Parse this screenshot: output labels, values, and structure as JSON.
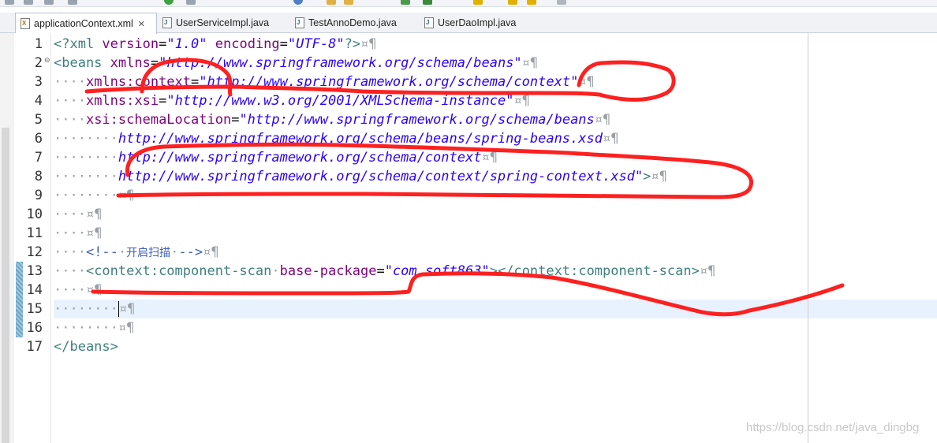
{
  "tabs": [
    {
      "label": "applicationContext.xml",
      "icon": "xml-file-icon",
      "active": true,
      "close": "✕"
    },
    {
      "label": "UserServiceImpl.java",
      "icon": "java-file-icon",
      "active": false
    },
    {
      "label": "TestAnnoDemo.java",
      "icon": "java-file-icon",
      "active": false
    },
    {
      "label": "UserDaoImpl.java",
      "icon": "java-file-icon",
      "active": false
    }
  ],
  "line_numbers": [
    "1",
    "2",
    "3",
    "4",
    "5",
    "6",
    "7",
    "8",
    "9",
    "10",
    "11",
    "12",
    "13",
    "14",
    "15",
    "16",
    "17"
  ],
  "code": {
    "l1": {
      "t1": "<?xml ",
      "a1": "version",
      "eq1": "=",
      "v1": "\"1.0\"",
      "sp": " ",
      "a2": "encoding",
      "eq2": "=",
      "v2": "\"UTF-8\"",
      "t2": "?>",
      "ws": "¤¶"
    },
    "l2": {
      "t1": "<beans ",
      "a1": "xmlns",
      "eq": "=",
      "v1": "\"http://www.springframework.org/schema/beans\"",
      "ws": "¤¶"
    },
    "l3": {
      "ind": "····",
      "a1": "xmlns:context",
      "eq": "=",
      "v1": "\"http://www.springframework.org/schema/context\"",
      "ws": "¤¶"
    },
    "l4": {
      "ind": "····",
      "a1": "xmlns:xsi",
      "eq": "=",
      "v1": "\"http://www.w3.org/2001/XMLSchema-instance\"",
      "ws": "¤¶"
    },
    "l5": {
      "ind": "····",
      "a1": "xsi:schemaLocation",
      "eq": "=",
      "v1": "\"http://www.springframework.org/schema/beans",
      "ws": "¤¶"
    },
    "l6": {
      "ind": "········",
      "v1": "http://www.springframework.org/schema/beans/spring-beans.xsd",
      "ws": "¤¶"
    },
    "l7": {
      "ind": "········",
      "v1": "http://www.springframework.org/schema/context",
      "ws": "¤¶"
    },
    "l8": {
      "ind": "········",
      "v1": "http://www.springframework.org/schema/context/spring-context.xsd\"",
      "t1": ">",
      "ws": "¤¶"
    },
    "l9": {
      "ind": "········",
      "ws": "¤¶"
    },
    "l10": {
      "ind": "····",
      "ws": "¤¶"
    },
    "l11": {
      "ind": "····",
      "ws": "¤¶"
    },
    "l12": {
      "ind": "····",
      "c1": "<!--",
      "sp1": "·",
      "cjk": "开启扫描",
      "sp2": "·",
      "c2": "-->",
      "ws": "¤¶"
    },
    "l13": {
      "ind": "····",
      "t1": "<context:component-scan",
      "sp": "·",
      "a1": "base-package",
      "eq": "=",
      "v1": "\"com.soft863\"",
      "t2": "></context:component-scan>",
      "ws": "¤¶"
    },
    "l14": {
      "ind": "····",
      "ws": "¤¶"
    },
    "l15": {
      "ind": "········",
      "ws": "¤¶"
    },
    "l16": {
      "ind": "········",
      "ws": "¤¶"
    },
    "l17": {
      "t1": "</beans>"
    }
  },
  "watermark": "https://blog.csdn.net/java_dingbg",
  "colors": {
    "tag": "#3f7f7f",
    "attr": "#7f007f",
    "value": "#2a00ff",
    "comment": "#3f5fbf",
    "annotation": "#ff2020",
    "current_line": "#e8f2fe"
  }
}
